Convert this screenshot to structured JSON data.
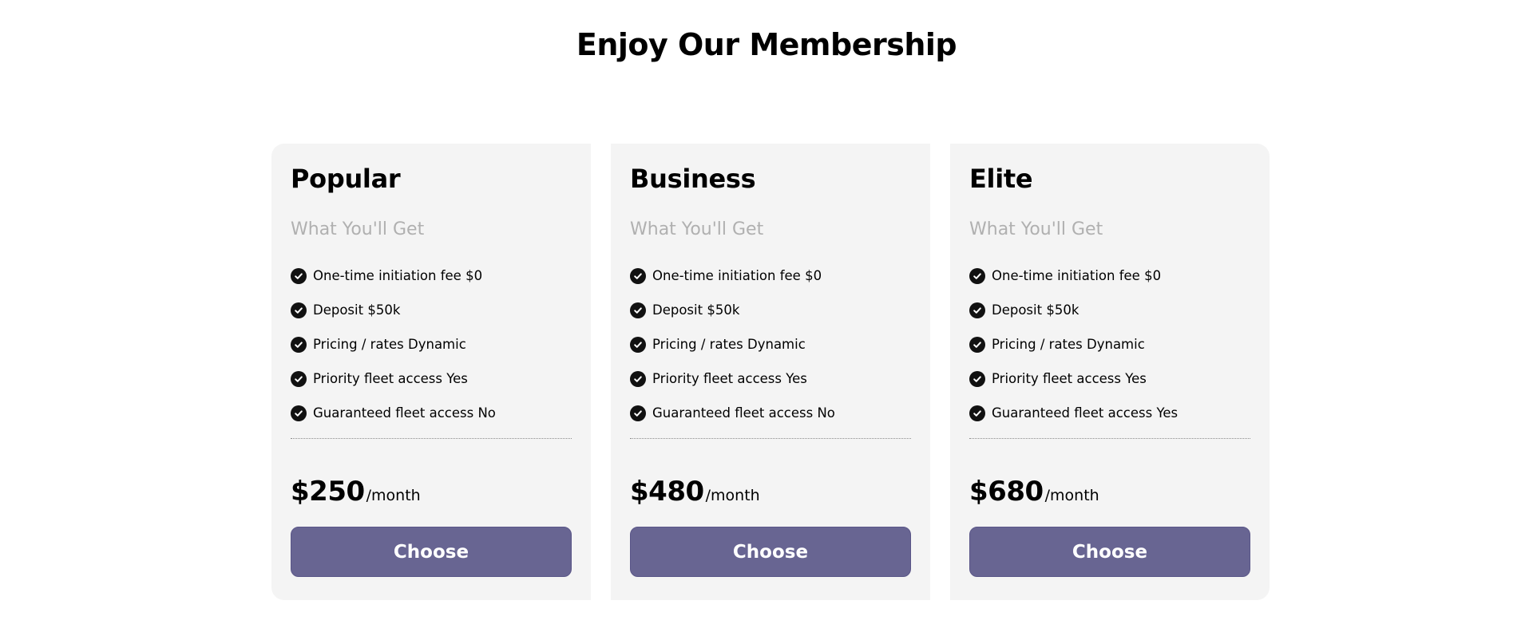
{
  "title": "Enjoy Our Membership",
  "colors": {
    "card_background": "#f4f4f4",
    "button": "#686592",
    "subtitle": "#b0b0b0",
    "check": "#111111"
  },
  "plans": [
    {
      "name": "Popular",
      "subtitle": "What You'll Get",
      "features": [
        "One-time initiation fee $0",
        "Deposit $50k",
        "Pricing / rates Dynamic",
        "Priority fleet access Yes",
        "Guaranteed fleet access No"
      ],
      "price": "$250",
      "period": "/month",
      "button": "Choose"
    },
    {
      "name": "Business",
      "subtitle": "What You'll Get",
      "features": [
        "One-time initiation fee $0",
        "Deposit $50k",
        "Pricing / rates Dynamic",
        "Priority fleet access Yes",
        "Guaranteed fleet access No"
      ],
      "price": "$480",
      "period": "/month",
      "button": "Choose"
    },
    {
      "name": "Elite",
      "subtitle": "What You'll Get",
      "features": [
        "One-time initiation fee $0",
        "Deposit $50k",
        "Pricing / rates Dynamic",
        "Priority fleet access Yes",
        "Guaranteed fleet access Yes"
      ],
      "price": "$680",
      "period": "/month",
      "button": "Choose"
    }
  ],
  "icons": {
    "feature": "check-circle-icon"
  }
}
